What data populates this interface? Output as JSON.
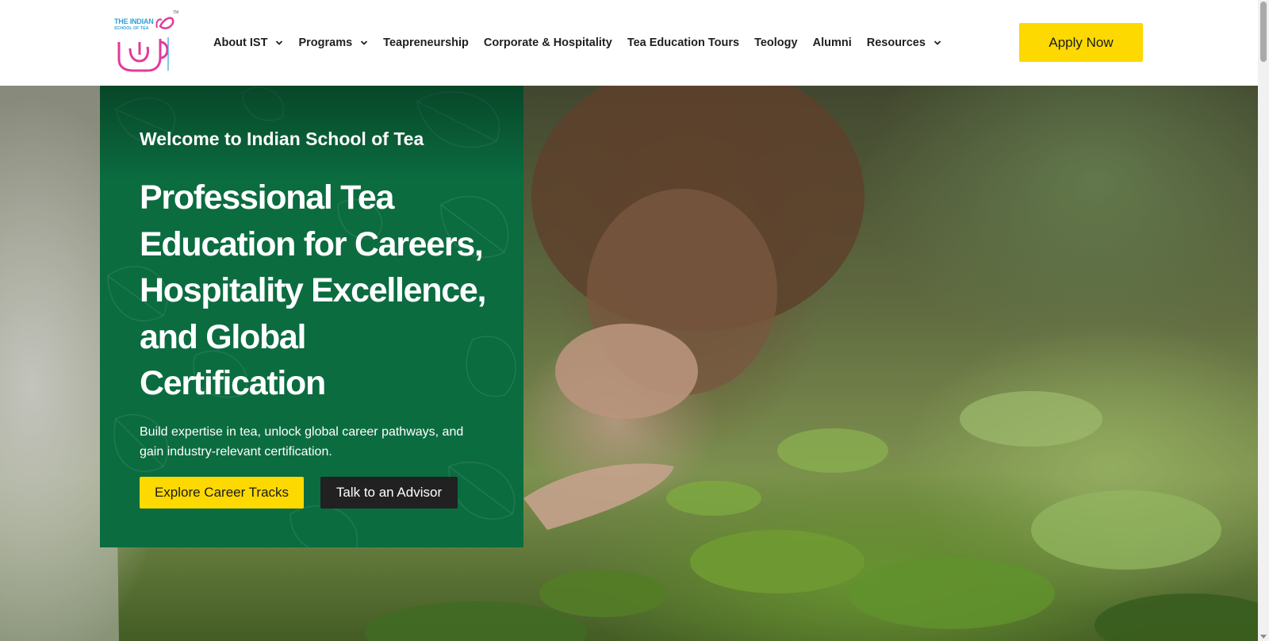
{
  "header": {
    "logo": {
      "line1": "THE INDIAN",
      "line2": "SCHOOL OF TEA",
      "tm": "TM"
    },
    "nav": [
      {
        "label": "About IST",
        "has_dropdown": true,
        "icon": "chevron-down-icon"
      },
      {
        "label": "Programs",
        "has_dropdown": true,
        "icon": "chevron-down-icon"
      },
      {
        "label": "Teapreneurship",
        "has_dropdown": false
      },
      {
        "label": "Corporate & Hospitality",
        "has_dropdown": false
      },
      {
        "label": "Tea Education Tours",
        "has_dropdown": false
      },
      {
        "label": "Teology",
        "has_dropdown": false
      },
      {
        "label": "Alumni",
        "has_dropdown": false
      },
      {
        "label": "Resources",
        "has_dropdown": true,
        "icon": "chevron-down-icon"
      }
    ],
    "apply_label": "Apply Now"
  },
  "hero": {
    "welcome": "Welcome to Indian School of Tea",
    "headline": "Professional Tea Education for Careers, Hospitality Excellence, and Global Certification",
    "subtext": "Build expertise in tea, unlock global career pathways, and gain industry-relevant certification.",
    "cta_primary": "Explore Career Tracks",
    "cta_secondary": "Talk to an Advisor"
  },
  "colors": {
    "accent_yellow": "#fdd900",
    "card_green": "#0b6c40",
    "dark_button": "#212121",
    "logo_blue": "#2f9fd8",
    "logo_pink": "#e23a9a"
  }
}
